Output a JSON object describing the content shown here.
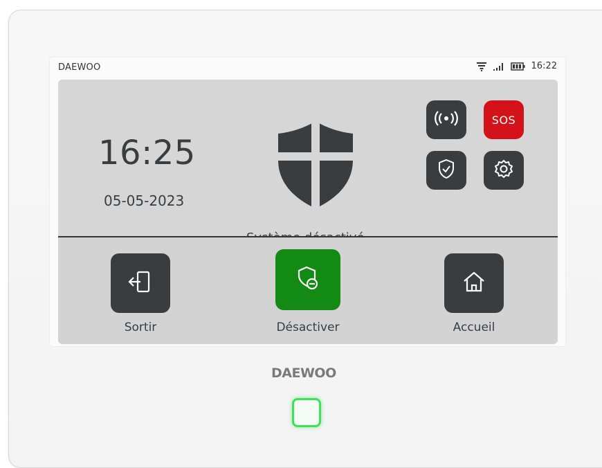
{
  "statusbar": {
    "brand": "DAEWOO",
    "wifi_icon": "wifi-icon",
    "signal_icon": "signal-bars-icon",
    "battery_icon": "battery-icon",
    "clock": "16:22"
  },
  "main": {
    "time": "16:25",
    "date": "05-05-2023",
    "shield_icon": "shield-cross-icon",
    "status": "Système désactivé"
  },
  "quick_actions": {
    "wireless_icon": "wireless-signal-icon",
    "sos_label": "SOS",
    "shield_check_icon": "shield-check-icon",
    "settings_icon": "gear-icon"
  },
  "actions": [
    {
      "label": "Sortir",
      "icon": "exit-door-icon"
    },
    {
      "label": "Désactiver",
      "icon": "shield-minus-icon"
    },
    {
      "label": "Accueil",
      "icon": "home-icon"
    }
  ],
  "device": {
    "logo": "DAEWOO",
    "led_color": "#3fe05a"
  },
  "colors": {
    "button_dark": "#3a3d40",
    "sos_red": "#d4121a",
    "deactivate_green": "#138a13",
    "panel_gray": "#d6d6d6"
  }
}
